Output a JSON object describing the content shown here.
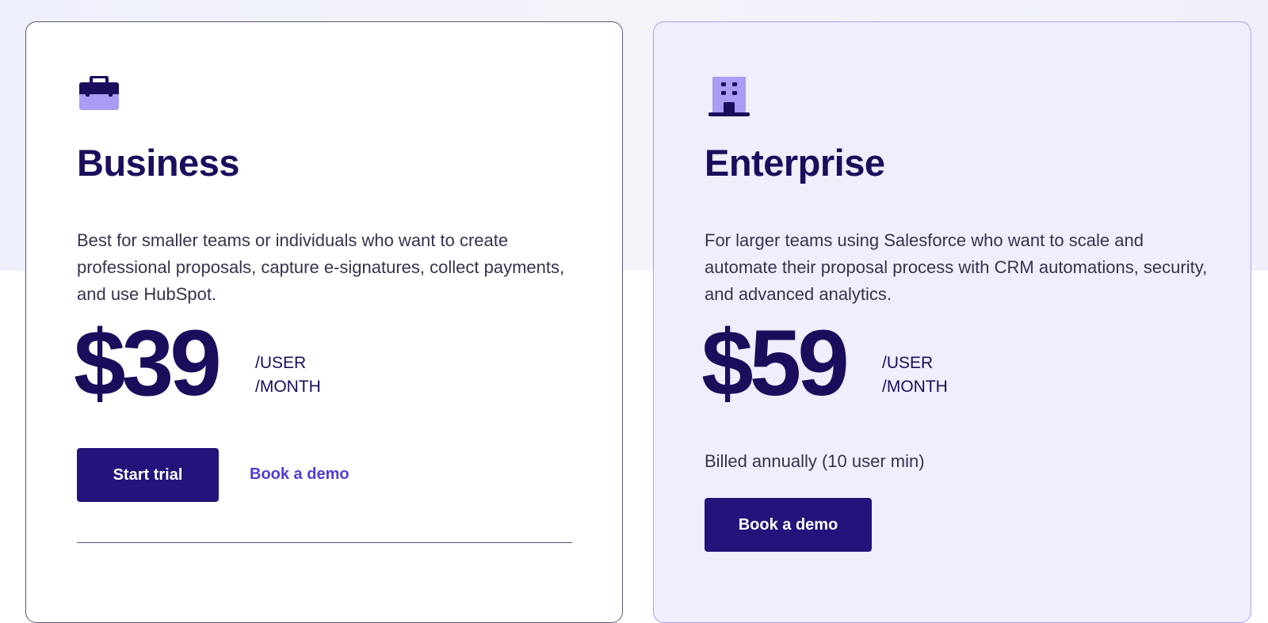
{
  "plans": {
    "business": {
      "icon": "briefcase-icon",
      "name": "Business",
      "description": "Best for smaller teams or individuals who want to create professional proposals, capture e-signatures, collect payments, and use HubSpot.",
      "price": "$39",
      "unit_line1": "/USER",
      "unit_line2": "/MONTH",
      "primary_button": "Start trial",
      "secondary_link": "Book a demo"
    },
    "enterprise": {
      "icon": "office-building-icon",
      "name": "Enterprise",
      "description": "For larger teams using Salesforce who want to scale and automate their proposal process with CRM automations, security, and advanced analytics.",
      "price": "$59",
      "unit_line1": "/USER",
      "unit_line2": "/MONTH",
      "billing_note": "Billed annually (10 user min)",
      "primary_button": "Book a demo"
    }
  },
  "colors": {
    "brand_dark": "#1c0d5c",
    "button": "#22147a",
    "link": "#4f3fd0",
    "icon_light": "#a89cf4",
    "enterprise_card_bg": "#efeefc"
  }
}
